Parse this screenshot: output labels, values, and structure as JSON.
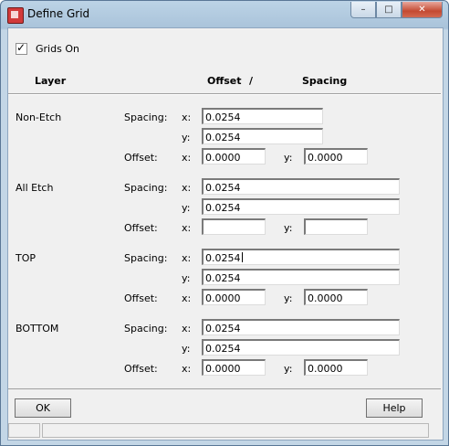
{
  "window": {
    "title": "Define Grid",
    "minimize": "–",
    "maximize": "□",
    "close": "✕"
  },
  "grids_on": {
    "label": "Grids On",
    "checked": true
  },
  "header": {
    "layer": "Layer",
    "offset": "Offset",
    "slash": "/",
    "spacing": "Spacing"
  },
  "field_labels": {
    "spacing": "Spacing:",
    "offset": "Offset:",
    "x": "x:",
    "y": "y:"
  },
  "layers": [
    {
      "name": "Non-Etch",
      "spacing_x": "0.0254",
      "spacing_y": "0.0254",
      "offset_x": "0.0000",
      "offset_y": "0.0000"
    },
    {
      "name": "All Etch",
      "spacing_x": "0.0254",
      "spacing_y": "0.0254",
      "offset_x": "",
      "offset_y": ""
    },
    {
      "name": "TOP",
      "spacing_x": "0.0254",
      "spacing_y": "0.0254",
      "offset_x": "0.0000",
      "offset_y": "0.0000"
    },
    {
      "name": "BOTTOM",
      "spacing_x": "0.0254",
      "spacing_y": "0.0254",
      "offset_x": "0.0000",
      "offset_y": "0.0000"
    }
  ],
  "buttons": {
    "ok": "OK",
    "help": "Help"
  },
  "colors": {
    "title_bar": "#bcd3e6",
    "dialog_bg": "#f0f0f0",
    "close_button": "#c44a32"
  }
}
